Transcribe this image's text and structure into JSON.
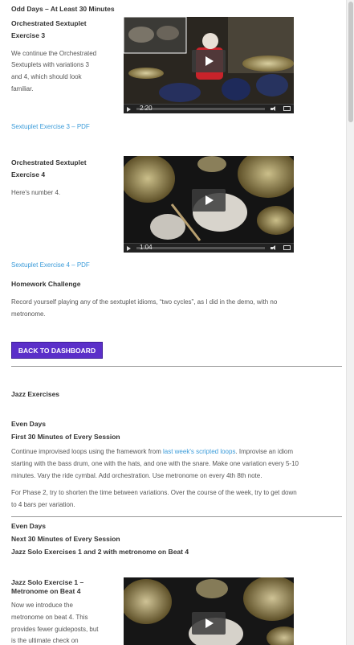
{
  "sections": {
    "odd_days_title": "Odd Days – At Least 30 Minutes",
    "ex3_title_1": "Orchestrated Sextuplet",
    "ex3_title_2": "Exercise 3",
    "ex3_desc_1": "We continue the Orchestrated",
    "ex3_desc_2": "Sextuplets with variations 3",
    "ex3_desc_3": "and 4, which should look",
    "ex3_desc_4": "familiar.",
    "ex3_pdf": "Sextuplet Exercise 3 – PDF",
    "ex4_title_1": "Orchestrated Sextuplet",
    "ex4_title_2": "Exercise 4",
    "ex4_desc": "Here's number 4.",
    "ex4_pdf": "Sextuplet Exercise 4 – PDF",
    "homework_title": "Homework Challenge",
    "homework_1": "Record yourself playing any of the sextuplet idioms, “two cycles”, as I did in the demo, with no",
    "homework_2": "metronome.",
    "back_button": "BACK TO DASHBOARD",
    "jazz_title": "Jazz Exercises",
    "even_days_1": "Even Days",
    "first30": "First 30 Minutes of Every Session",
    "cont_pre": "Continue improvised loops using the framework from ",
    "cont_link": "last week's scripted loops",
    "cont_post": ". Improvise an idiom",
    "cont_2": "starting with the bass drum, one with the hats, and one with the snare. Make one variation every 5-10",
    "cont_3": "minutes. Vary the ride cymbal. Add orchestration. Use metronome on every 4th 8th note.",
    "phase2_1": "For Phase 2, try to shorten the time between variations. Over the course of the week, try to get down",
    "phase2_2": "to 4 bars per variation.",
    "even_days_2": "Even Days",
    "next30": "Next 30 Minutes of Every Session",
    "jazz_solo_heading": "Jazz Solo Exercises 1 and 2 with metronome on Beat 4",
    "jazz1_title_1": "Jazz Solo Exercise 1 –",
    "jazz1_title_2": "Metronome on Beat 4",
    "jazz1_desc_1": "Now we introduce the",
    "jazz1_desc_2": "metronome on beat 4. This",
    "jazz1_desc_3": "provides fewer guideposts, but",
    "jazz1_desc_4": "is the ultimate check on"
  },
  "videos": {
    "v1_time": "2:20",
    "v2_time": "1:04"
  },
  "colors": {
    "link": "#3a9bd9",
    "button_bg": "#5b2fc9",
    "heading": "#333333",
    "body": "#555555"
  },
  "icons": [
    "play-icon",
    "volume-icon",
    "fullscreen-icon"
  ]
}
